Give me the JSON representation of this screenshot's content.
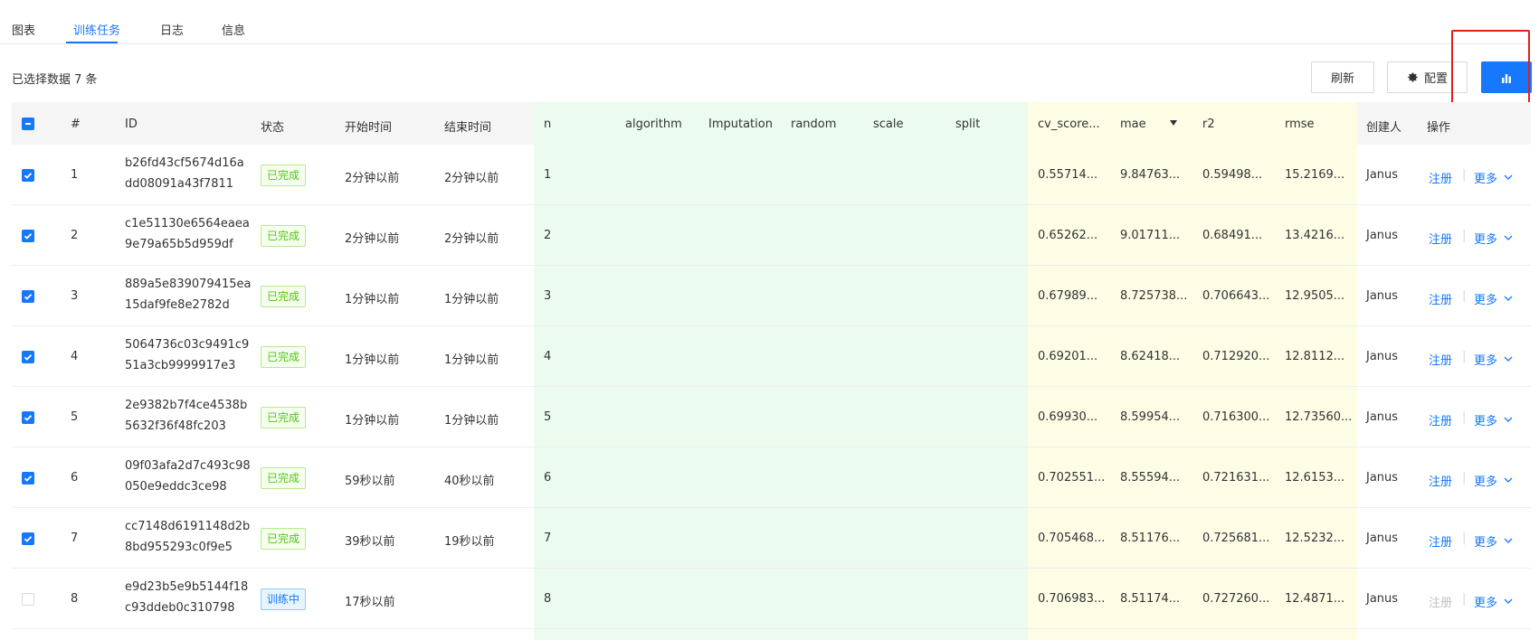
{
  "tabs": [
    "图表",
    "训练任务",
    "日志",
    "信息"
  ],
  "toolbar": {
    "selected_text": "已选择数据 7 条",
    "refresh_label": "刷新",
    "config_label": "配置"
  },
  "columns": [
    "#",
    "ID",
    "状态",
    "开始时间",
    "结束时间",
    "n",
    "algorithm",
    "Imputation",
    "random",
    "scale",
    "split",
    "cv_score...",
    "mae",
    "r2",
    "rmse",
    "创建人",
    "操作"
  ],
  "actions": {
    "register": "注册",
    "more": "更多",
    "separator": "|"
  },
  "rows": [
    {
      "num": "1",
      "id1": "b26fd43cf5674d16a",
      "id2": "dd08091a43f7811",
      "status": "已完成",
      "start": "2分钟以前",
      "end": "2分钟以前",
      "n": "1",
      "cv": "0.55714...",
      "mae": "9.84763...",
      "r2": "0.59498...",
      "rmse": "15.2169...",
      "creator": "Janus"
    },
    {
      "num": "2",
      "id1": "c1e51130e6564eaea",
      "id2": "9e79a65b5d959df",
      "status": "已完成",
      "start": "2分钟以前",
      "end": "2分钟以前",
      "n": "2",
      "cv": "0.65262...",
      "mae": "9.01711...",
      "r2": "0.68491...",
      "rmse": "13.4216...",
      "creator": "Janus"
    },
    {
      "num": "3",
      "id1": "889a5e839079415ea",
      "id2": "15daf9fe8e2782d",
      "status": "已完成",
      "start": "1分钟以前",
      "end": "1分钟以前",
      "n": "3",
      "cv": "0.67989...",
      "mae": "8.725738...",
      "r2": "0.706643...",
      "rmse": "12.9505...",
      "creator": "Janus"
    },
    {
      "num": "4",
      "id1": "5064736c03c9491c9",
      "id2": "51a3cb9999917e3",
      "status": "已完成",
      "start": "1分钟以前",
      "end": "1分钟以前",
      "n": "4",
      "cv": "0.69201...",
      "mae": "8.62418...",
      "r2": "0.712920...",
      "rmse": "12.8112...",
      "creator": "Janus"
    },
    {
      "num": "5",
      "id1": "2e9382b7f4ce4538b",
      "id2": "5632f36f48fc203",
      "status": "已完成",
      "start": "1分钟以前",
      "end": "1分钟以前",
      "n": "5",
      "cv": "0.69930...",
      "mae": "8.59954...",
      "r2": "0.716300...",
      "rmse": "12.73560...",
      "creator": "Janus"
    },
    {
      "num": "6",
      "id1": "09f03afa2d7c493c98",
      "id2": "050e9eddc3ce98",
      "status": "已完成",
      "start": "59秒以前",
      "end": "40秒以前",
      "n": "6",
      "cv": "0.702551...",
      "mae": "8.55594...",
      "r2": "0.721631...",
      "rmse": "12.6153...",
      "creator": "Janus"
    },
    {
      "num": "7",
      "id1": "cc7148d6191148d2b",
      "id2": "8bd955293c0f9e5",
      "status": "已完成",
      "start": "39秒以前",
      "end": "19秒以前",
      "n": "7",
      "cv": "0.705468...",
      "mae": "8.51176...",
      "r2": "0.725681...",
      "rmse": "12.5232...",
      "creator": "Janus"
    },
    {
      "num": "8",
      "id1": "e9d23b5e9b5144f18",
      "id2": "c93ddeb0c310798",
      "status": "训练中",
      "start": "17秒以前",
      "end": "",
      "n": "8",
      "cv": "0.706983...",
      "mae": "8.51174...",
      "r2": "0.727260...",
      "rmse": "12.4871...",
      "creator": "Janus"
    }
  ]
}
